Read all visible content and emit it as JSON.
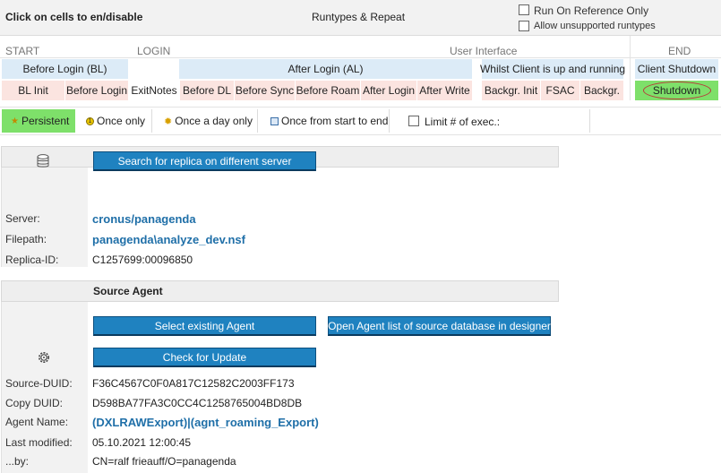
{
  "header": {
    "title": "Click on cells to en/disable",
    "center_label": "Runtypes & Repeat",
    "run_on_reference_only": "Run On Reference Only",
    "allow_unsupported": "Allow unsupported runtypes"
  },
  "phases": {
    "start": "START",
    "login": "LOGIN",
    "user_interface": "User Interface",
    "end": "END"
  },
  "groups": {
    "before_login": "Before Login (BL)",
    "after_login": "After Login (AL)",
    "whilst_client": "Whilst Client is up and running",
    "client_shutdown": "Client Shutdown"
  },
  "runtypes": {
    "bl_init": "BL Init",
    "before_login": "Before Login",
    "exit_notes": "ExitNotes",
    "before_dl": "Before DL",
    "before_sync": "Before Sync",
    "before_roam": "Before Roam",
    "after_login": "After Login",
    "after_write": "After Write",
    "backgr_init": "Backgr. Init",
    "fsac": "FSAC",
    "backgr": "Backgr.",
    "shutdown": "Shutdown"
  },
  "repeat": {
    "persistent": "Persistent",
    "once_only": "Once only",
    "once_a_day": "Once a day only",
    "once_start_end": "Once from start to end",
    "limit": "Limit # of exec.:"
  },
  "replica": {
    "button": "Search for replica on different server",
    "server_label": "Server:",
    "server_value": "cronus/panagenda",
    "filepath_label": "Filepath:",
    "filepath_value": "panagenda\\analyze_dev.nsf",
    "replica_label": "Replica-ID:",
    "replica_value": "C1257699:00096850"
  },
  "agent": {
    "title": "Source Agent",
    "select_button": "Select existing Agent",
    "open_list_button": "Open Agent list of source database in designer",
    "check_update_button": "Check for Update",
    "source_duid_label": "Source-DUID:",
    "source_duid_value": "F36C4567C0F0A817C12582C2003FF173",
    "copy_duid_label": "Copy DUID:",
    "copy_duid_value": "D598BA77FA3C0CC4C1258765004BD8DB",
    "agent_name_label": "Agent Name:",
    "agent_name_value": "(DXLRAWExport)|(agnt_roaming_Export)",
    "last_modified_label": "Last modified:",
    "last_modified_value": "05.10.2021 12:00:45",
    "by_label": "...by:",
    "by_value": "CN=ralf frieauff/O=panagenda"
  },
  "colors": {
    "button_blue": "#1f82c0",
    "green_active": "#7ee06a",
    "cell_blue": "#dcebf7",
    "cell_pink": "#fbe4e0",
    "link_blue": "#1f6fa8"
  }
}
